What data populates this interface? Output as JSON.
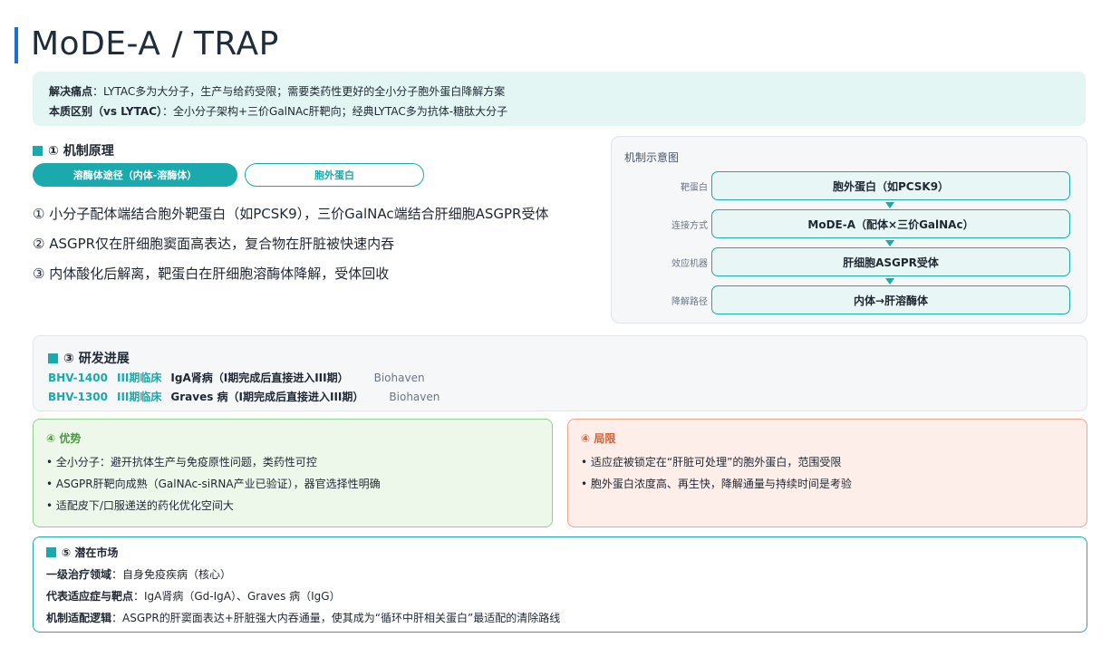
{
  "page": {
    "title": "MoDE-A / TRAP"
  },
  "summary": {
    "pain_label": "解决痛点",
    "pain_text": "：LYTAC多为大分子，生产与给药受限；需要类药性更好的全小分子胞外蛋白降解方案",
    "diff_label": "本质区别（vs LYTAC）",
    "diff_text": "：全小分子架构+三价GalNAc肝靶向；经典LYTAC多为抗体-糖肽大分子"
  },
  "mechanism": {
    "heading": "① 机制原理",
    "tabs": [
      "溶酶体途径（内体-溶酶体）",
      "胞外蛋白"
    ],
    "lines": [
      "① 小分子配体端结合胞外靶蛋白（如PCSK9），三价GalNAc端结合肝细胞ASGPR受体",
      "② ASGPR仅在肝细胞窦面高表达，复合物在肝脏被快速内吞",
      "③ 内体酸化后解离，靶蛋白在肝细胞溶酶体降解，受体回收"
    ]
  },
  "diagram": {
    "title": "机制示意图",
    "rows": [
      {
        "label": "靶蛋白",
        "value": "胞外蛋白（如PCSK9）"
      },
      {
        "label": "连接方式",
        "value": "MoDE-A（配体×三价GalNAc）"
      },
      {
        "label": "效应机器",
        "value": "肝细胞ASGPR受体"
      },
      {
        "label": "降解路径",
        "value": "内体→肝溶酶体"
      }
    ]
  },
  "progress": {
    "heading": "③ 研发进展",
    "items": [
      {
        "code": "BHV-1400",
        "phase": "III期临床",
        "desc": "IgA肾病（I期完成后直接进入III期）",
        "company": "Biohaven"
      },
      {
        "code": "BHV-1300",
        "phase": "III期临床",
        "desc": "Graves 病（I期完成后直接进入III期）",
        "company": "Biohaven"
      }
    ]
  },
  "advantages": {
    "heading": "④ 优势",
    "items": [
      "• 全小分子：避开抗体生产与免疫原性问题，类药性可控",
      "• ASGPR肝靶向成熟（GalNAc-siRNA产业已验证），器官选择性明确",
      "• 适配皮下/口服递送的药化优化空间大"
    ]
  },
  "limits": {
    "heading": "④ 局限",
    "items": [
      "• 适应症被锁定在“肝脏可处理”的胞外蛋白，范围受限",
      "• 胞外蛋白浓度高、再生快，降解通量与持续时间是考验"
    ]
  },
  "market": {
    "heading": "⑤ 潜在市场",
    "lines": [
      {
        "label": "一级治疗领域",
        "text": "：自身免疫疾病（核心）"
      },
      {
        "label": "代表适应症与靶点",
        "text": "：IgA肾病（Gd-IgA）、Graves 病（IgG）"
      },
      {
        "label": "机制适配逻辑",
        "text": "：ASGPR的肝窦面表达+肝脏强大内吞通量，使其成为“循环中肝相关蛋白”最适配的清除路线"
      }
    ]
  },
  "colors": {
    "accent": "#1aa9ad",
    "title_bar": "#1a6fd4",
    "advantage": "#4a9a3a",
    "limit": "#e05a2a"
  }
}
